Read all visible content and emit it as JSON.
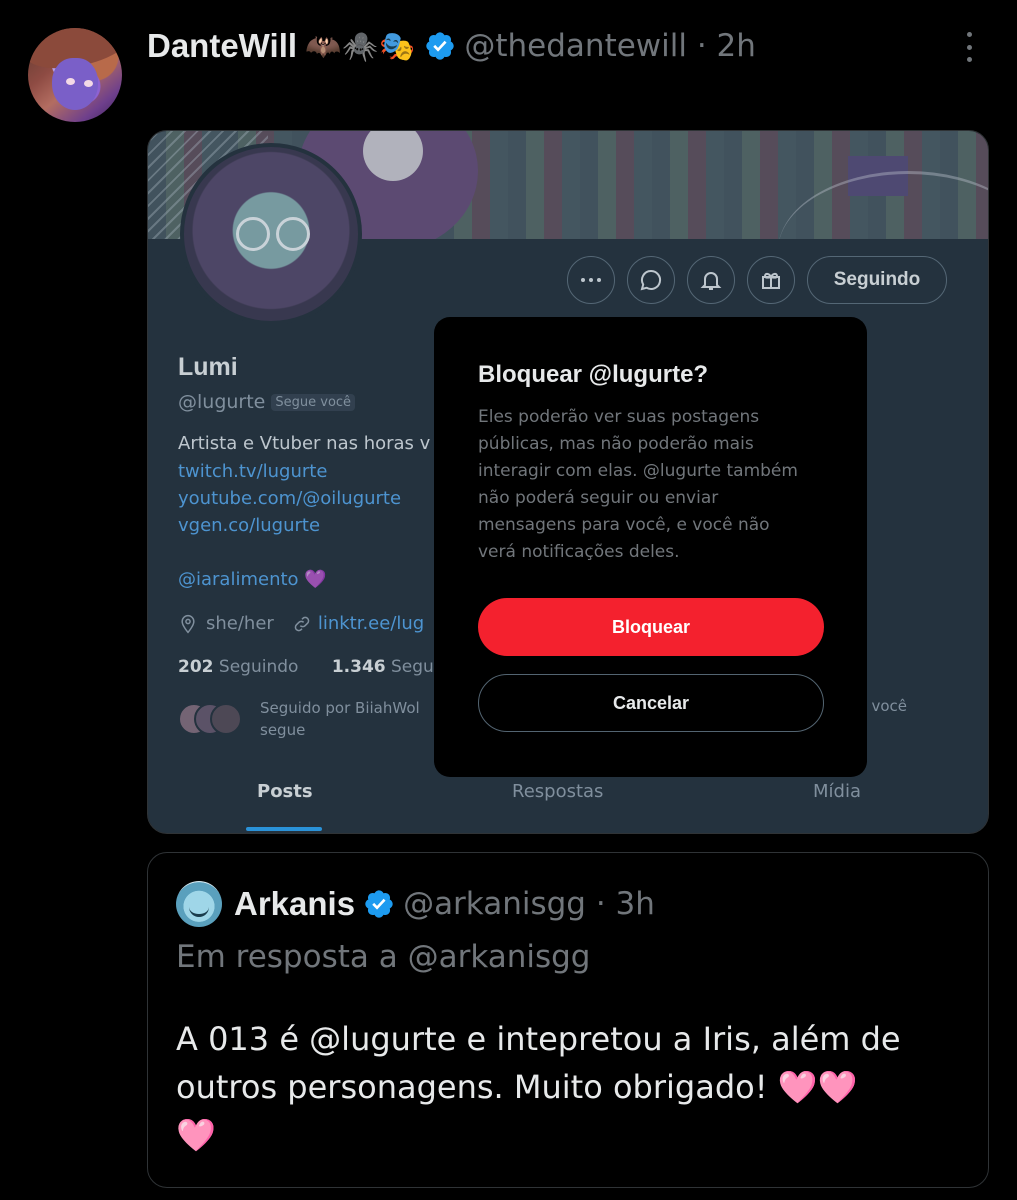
{
  "tweet": {
    "display_name": "DanteWill",
    "name_emojis": "🦇🕷️🎭",
    "handle": "@thedantewill",
    "time": "2h",
    "handle_time": "@thedantewill · 2h"
  },
  "profile": {
    "name": "Lumi",
    "handle": "@lugurte",
    "follows_you_badge": "Segue você",
    "bio": "Artista e Vtuber nas horas v",
    "links": [
      "twitch.tv/lugurte",
      "youtube.com/@oilugurte",
      "vgen.co/lugurte"
    ],
    "mention": "@iaralimento",
    "mention_emoji": "💜",
    "pronouns": "she/her",
    "website": "linktr.ee/lug",
    "following_count": "202",
    "following_label": "Seguindo",
    "followers_count": "1.346",
    "followers_label": "Segui",
    "followed_by_line1": "Seguido por BiiahWol",
    "followed_by_line2": "segue",
    "followed_by_right": "ue você",
    "following_button": "Seguindo",
    "tabs": [
      "Posts",
      "Respostas",
      "Mídia"
    ]
  },
  "dialog": {
    "title": "Bloquear @lugurte?",
    "lines": [
      "Eles poderão ver suas postagens",
      "públicas, mas não poderão mais",
      "interagir com elas. @lugurte também",
      "não poderá seguir ou enviar",
      "mensagens para você, e você não",
      "verá notificações deles."
    ],
    "block_label": "Bloquear",
    "cancel_label": "Cancelar",
    "block_color": "#f4212e"
  },
  "quote": {
    "name": "Arkanis",
    "handle_time": "@arkanisgg · 3h",
    "reply_to": "Em resposta a @arkanisgg",
    "text_lines": [
      "A 013 é @lugurte  e intepretou a Iris, além de",
      "outros personagens. Muito obrigado! 🩷🩷",
      "🩷"
    ]
  },
  "colors": {
    "verified": "#1d9bf0",
    "link": "#4a9ee6",
    "muted": "#71767b"
  }
}
